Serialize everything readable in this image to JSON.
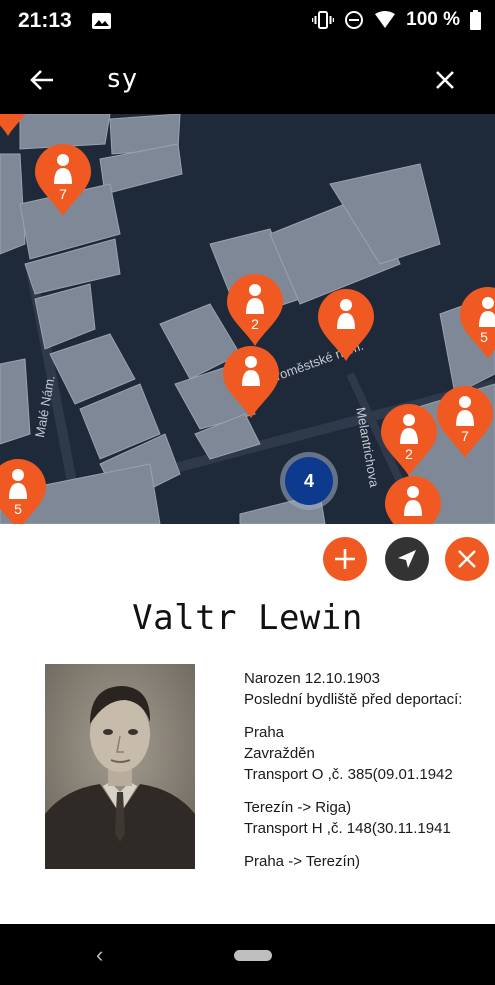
{
  "status_bar": {
    "time": "21:13",
    "battery": "100 %",
    "icons": [
      "image-icon",
      "vibrate-icon",
      "dnd-icon",
      "wifi-icon",
      "battery-icon"
    ]
  },
  "search": {
    "value": "sy",
    "back_icon": "arrow-back-icon",
    "clear_icon": "close-icon"
  },
  "map": {
    "street_labels": [
      "Staroměstské nám.",
      "Malé Nám.",
      "Melantrichova"
    ],
    "pins": [
      {
        "count": "7"
      },
      {
        "count": "2"
      },
      {
        "count": ""
      },
      {
        "count": "5"
      },
      {
        "count": ""
      },
      {
        "count": "2"
      },
      {
        "count": "7"
      },
      {
        "count": "5"
      },
      {
        "count": ""
      },
      {
        "count": ""
      }
    ],
    "cluster_count": "4",
    "pin_color": "#f05a22",
    "cluster_color": "#0d3a8e"
  },
  "actions": {
    "add_icon": "plus-icon",
    "navigate_icon": "navigation-arrow-icon",
    "close_icon": "close-icon"
  },
  "person": {
    "name": "Valtr Lewin",
    "born": "Narozen 12.10.1903",
    "last_residence_label": "Poslední bydliště před deportací:",
    "city": "Praha",
    "fate": "Zavražděn",
    "transport1": "Transport O ,č. 385(09.01.1942",
    "route1": "Terezín -> Riga)",
    "transport2": "Transport H ,č. 148(30.11.1941",
    "route2": "Praha -> Terezín)"
  },
  "nav_bar": {
    "back": "‹"
  }
}
